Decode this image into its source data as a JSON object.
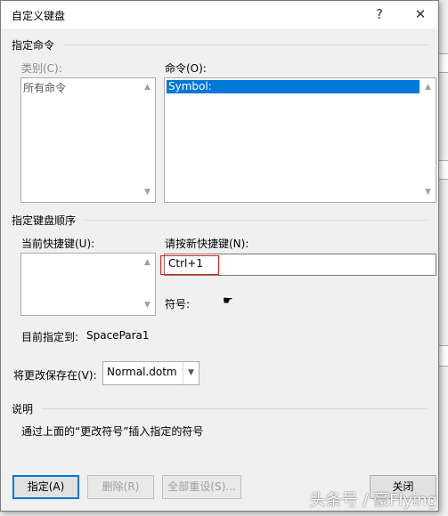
{
  "dialog": {
    "title": "自定义键盘",
    "help_icon": "?",
    "close_icon": "✕"
  },
  "command_group": {
    "title": "指定命令",
    "category_label": "类别(C):",
    "category_items": [
      "所有命令"
    ],
    "command_label": "命令(O):",
    "command_items": [
      "Symbol:"
    ],
    "selected_command": "Symbol:"
  },
  "keyboard_group": {
    "title": "指定键盘顺序",
    "current_keys_label": "当前快捷键(U):",
    "new_key_label": "请按新快捷键(N):",
    "new_key_value": "Ctrl+1",
    "symbol_label": "符号:",
    "symbol_value": "☛",
    "currently_assigned_label": "目前指定到:",
    "currently_assigned_value": "SpacePara1"
  },
  "save": {
    "label": "将更改保存在(V):",
    "value": "Normal.dotm"
  },
  "description": {
    "title": "说明",
    "text": "通过上面的“更改符号”插入指定的符号"
  },
  "buttons": {
    "assign": "指定(A)",
    "remove": "删除(R)",
    "reset_all": "全部重设(S)...",
    "close": "关闭"
  },
  "watermark": "头条号 / 豪Flying",
  "colors": {
    "selection": "#0078d7",
    "highlight_box": "#e02020",
    "default_button_border": "#0078d7"
  }
}
